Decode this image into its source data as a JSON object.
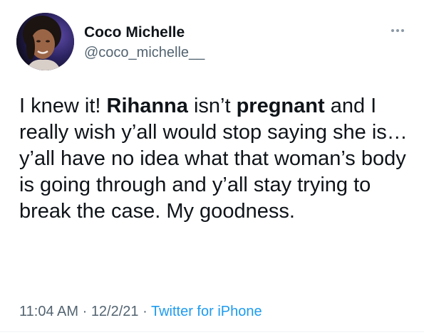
{
  "user": {
    "display_name": "Coco Michelle",
    "handle": "@coco_michelle__",
    "avatar_icon": "profile-photo"
  },
  "more_icon": "ellipsis-icon",
  "tweet": {
    "parts": [
      {
        "text": "I knew it! ",
        "bold": false
      },
      {
        "text": "Rihanna",
        "bold": true
      },
      {
        "text": " isn’t ",
        "bold": false
      },
      {
        "text": "pregnant",
        "bold": true
      },
      {
        "text": " and I really wish y’all would stop saying she is… y’all have no idea what that woman’s body is going through and y’all stay trying to break the case. My goodness.",
        "bold": false
      }
    ]
  },
  "meta": {
    "time": "11:04 AM",
    "separator": " · ",
    "date": "12/2/21",
    "source": "Twitter for iPhone"
  },
  "colors": {
    "text": "#0f1419",
    "secondary": "#536471",
    "link": "#1d9bf0"
  }
}
